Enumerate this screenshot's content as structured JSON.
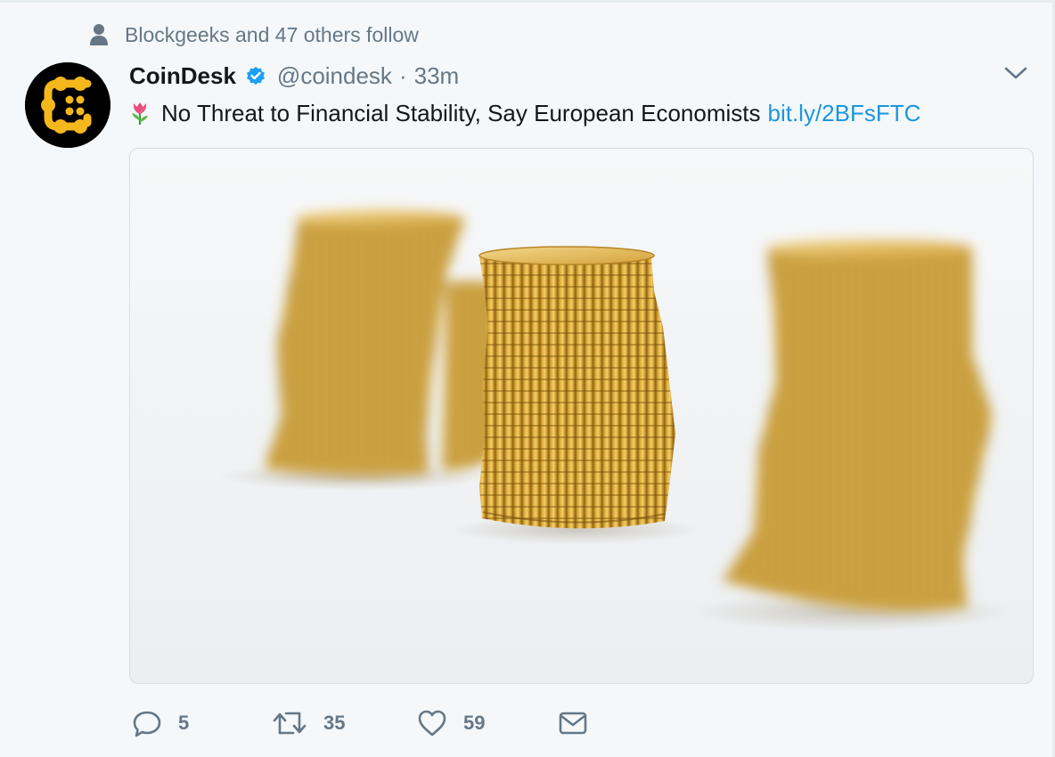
{
  "social_context": {
    "icon": "person-icon",
    "text": "Blockgeeks and 47 others follow"
  },
  "tweet": {
    "avatar_icon": "coindesk-logo",
    "name": "CoinDesk",
    "verified": true,
    "handle": "@coindesk",
    "separator": "·",
    "time": "33m",
    "text": "No Threat to Financial Stability, Say European Economists",
    "emoji": "tulip",
    "link": "bit.ly/2BFsFTC",
    "media_alt": "stacks of gold coins"
  },
  "actions": {
    "reply_count": "5",
    "retweet_count": "35",
    "like_count": "59"
  },
  "colors": {
    "background": "#f5f8fa",
    "secondary_text": "#657786",
    "link": "#1b95e0",
    "verified": "#1da1f2",
    "coin_gold": "#d4a52c"
  }
}
